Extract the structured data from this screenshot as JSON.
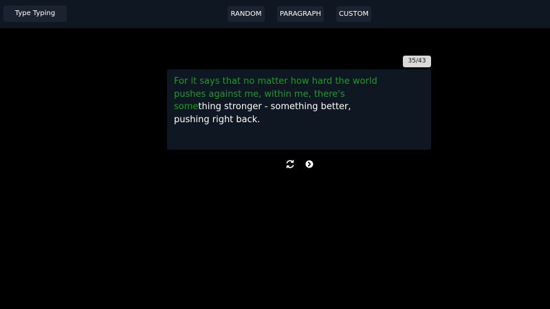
{
  "app": {
    "brand_label": "Type Typing"
  },
  "modes": {
    "random_label": "RANDOM",
    "paragraph_label": "PARAGRAPH",
    "custom_label": "CUSTOM"
  },
  "progress": {
    "counter_text": "35/43",
    "typed_words": 35,
    "total_words": 43
  },
  "passage": {
    "typed_text": "For it says that no matter how hard the world pushes against me, within me, there's some",
    "remaining_text": "thing stronger - something better, pushing right back."
  },
  "controls": {
    "restart_icon": "refresh-icon",
    "next_icon": "arrow-right-circle-icon"
  },
  "colors": {
    "typed": "#1f9a2d",
    "remaining": "#ffffff",
    "panel": "#0f1722",
    "background": "#000000"
  }
}
